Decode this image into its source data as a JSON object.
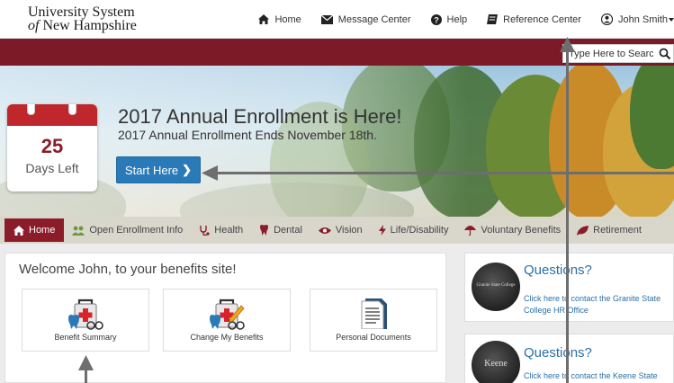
{
  "header": {
    "logo_line1": "University System",
    "logo_of": "of",
    "logo_line2": "New Hampshire",
    "nav": [
      {
        "label": "Home",
        "icon": "home-icon"
      },
      {
        "label": "Message Center",
        "icon": "envelope-icon"
      },
      {
        "label": "Help",
        "icon": "question-icon"
      },
      {
        "label": "Reference Center",
        "icon": "book-icon"
      },
      {
        "label": "John Smith",
        "icon": "user-icon"
      }
    ]
  },
  "search": {
    "placeholder": "Type Here to Search"
  },
  "hero": {
    "days_count": "25",
    "days_label": "Days Left",
    "title": "2017 Annual Enrollment is Here!",
    "subtitle": "2017 Annual Enrollment Ends November 18th.",
    "button_label": "Start Here"
  },
  "tabs": [
    {
      "label": "Home",
      "icon": "home-icon"
    },
    {
      "label": "Open Enrollment Info",
      "icon": "people-icon"
    },
    {
      "label": "Health",
      "icon": "stethoscope-icon"
    },
    {
      "label": "Dental",
      "icon": "tooth-icon"
    },
    {
      "label": "Vision",
      "icon": "eye-icon"
    },
    {
      "label": "Life/Disability",
      "icon": "bolt-icon"
    },
    {
      "label": "Voluntary Benefits",
      "icon": "umbrella-icon"
    },
    {
      "label": "Retirement",
      "icon": "leaf-icon"
    }
  ],
  "welcome": {
    "heading": "Welcome John, to your benefits site!",
    "cards": [
      {
        "label": "Benefit Summary"
      },
      {
        "label": "Change My Benefits"
      },
      {
        "label": "Personal Documents"
      }
    ]
  },
  "questions": [
    {
      "title": "Questions?",
      "link": "Click here to contact the Granite State College HR Office",
      "logo_text": "Granite State College"
    },
    {
      "title": "Questions?",
      "link": "Click here to contact the Keene State",
      "logo_text": "Keene"
    }
  ],
  "colors": {
    "maroon": "#7d1a27",
    "accent_blue": "#2a7ab7",
    "link_blue": "#2a6fa8",
    "tab_bg": "#d9d7cc"
  }
}
